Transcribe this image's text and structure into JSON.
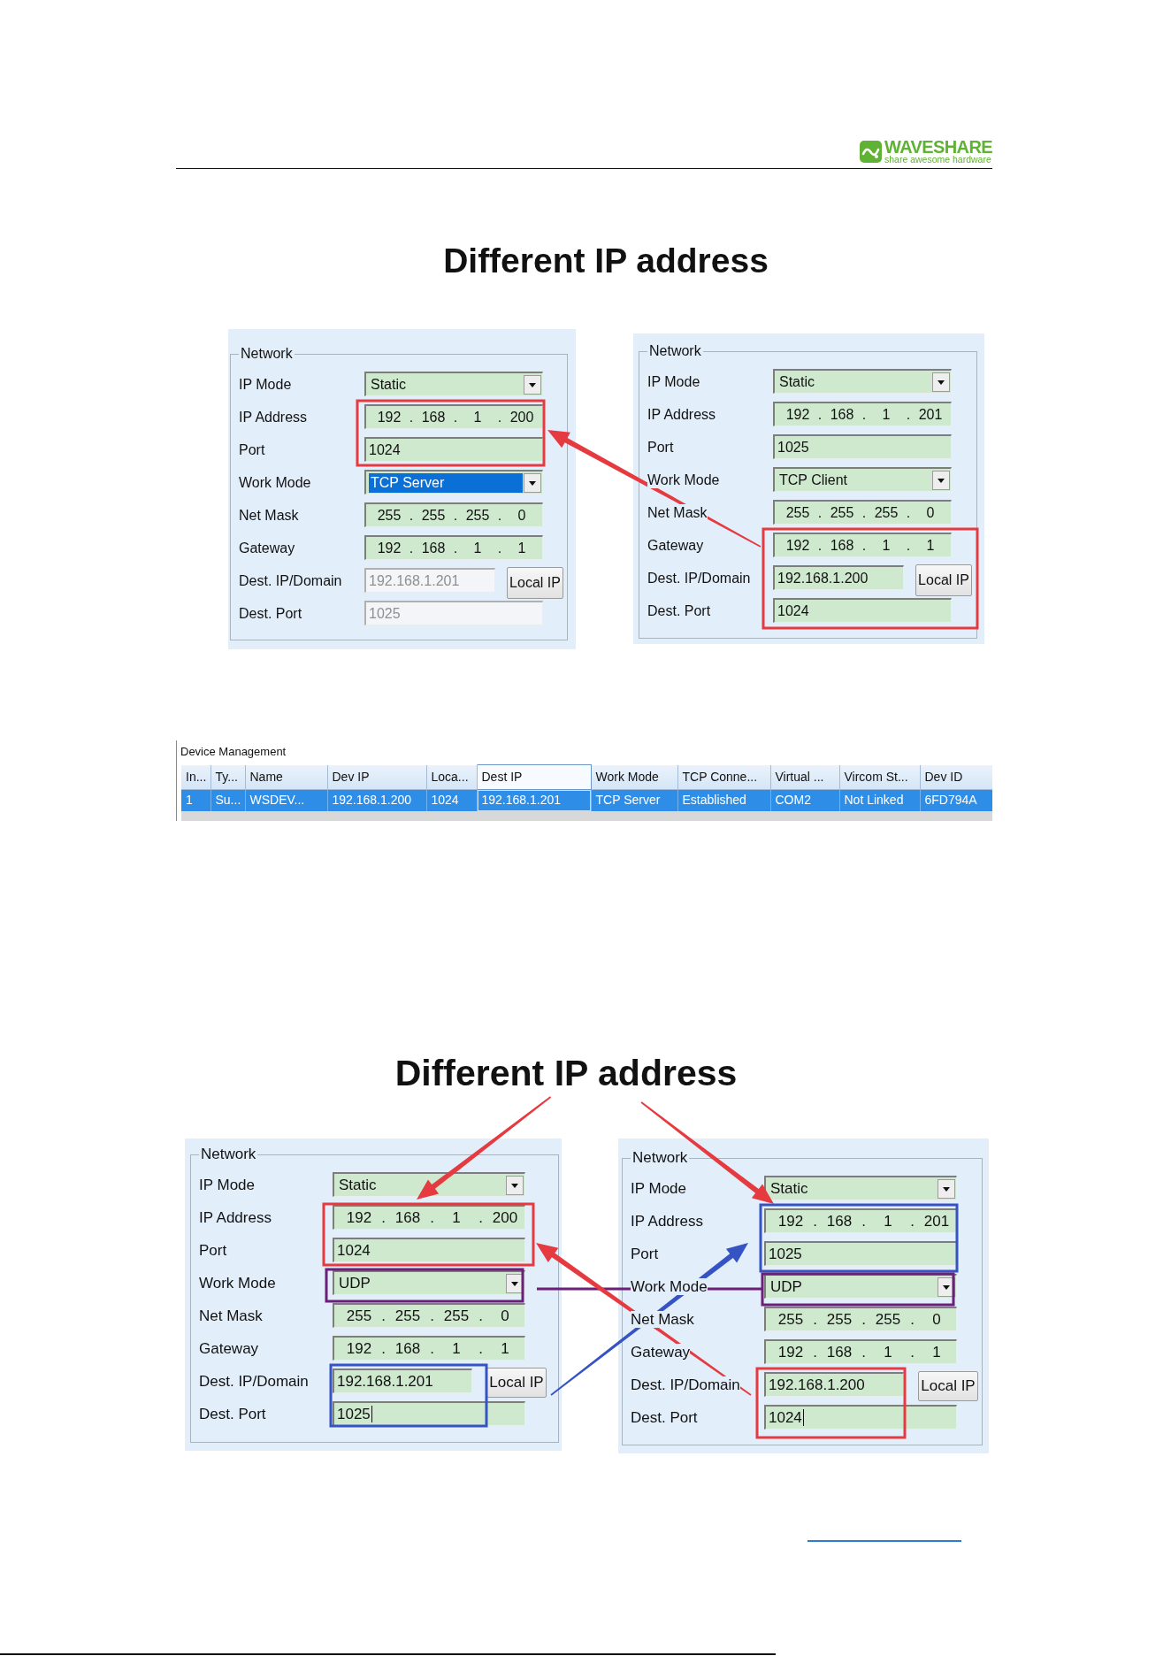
{
  "blocks": [
    {
      "kind": "header",
      "brand": "WAVESHARE",
      "tagline": "share awesome hardware"
    },
    {
      "kind": "figure",
      "title": "Different IP address",
      "panels": [
        {
          "group": "Network",
          "rows": [
            {
              "label": "IP Mode",
              "kind": "combo",
              "value": "Static",
              "disabled": false,
              "focused": false
            },
            {
              "label": "IP Address",
              "kind": "ip",
              "value": "192 . 168 . 1 . 200",
              "disabled": false,
              "focused": false
            },
            {
              "label": "Port",
              "kind": "text",
              "value": "1024",
              "disabled": false,
              "focused": false
            },
            {
              "label": "Work Mode",
              "kind": "combo",
              "value": "TCP Server",
              "disabled": false,
              "focused": true
            },
            {
              "label": "Net Mask",
              "kind": "ip",
              "value": "255 . 255 . 255 . 0",
              "disabled": false,
              "focused": false
            },
            {
              "label": "Gateway",
              "kind": "ip",
              "value": "192 . 168 . 1 . 1",
              "disabled": false,
              "focused": false
            },
            {
              "label": "Dest. IP/Domain",
              "kind": "text",
              "value": "192.168.1.201",
              "button": "Local IP",
              "disabled": true,
              "focused": false
            },
            {
              "label": "Dest. Port",
              "kind": "text",
              "value": "1025",
              "disabled": true,
              "focused": false
            }
          ]
        },
        {
          "group": "Network",
          "rows": [
            {
              "label": "IP Mode",
              "kind": "combo",
              "value": "Static",
              "disabled": false,
              "focused": false
            },
            {
              "label": "IP Address",
              "kind": "ip",
              "value": "192 . 168 . 1 . 201",
              "disabled": false,
              "focused": false
            },
            {
              "label": "Port",
              "kind": "text",
              "value": "1025",
              "disabled": false,
              "focused": false
            },
            {
              "label": "Work Mode",
              "kind": "combo",
              "value": "TCP Client",
              "disabled": false,
              "focused": false
            },
            {
              "label": "Net Mask",
              "kind": "ip",
              "value": "255 . 255 . 255 . 0",
              "disabled": false,
              "focused": false
            },
            {
              "label": "Gateway",
              "kind": "ip",
              "value": "192 . 168 . 1 . 1",
              "disabled": false,
              "focused": false
            },
            {
              "label": "Dest. IP/Domain",
              "kind": "text",
              "value": "192.168.1.200",
              "button": "Local IP",
              "disabled": false,
              "focused": false
            },
            {
              "label": "Dest. Port",
              "kind": "text",
              "value": "1024",
              "disabled": false,
              "focused": false
            }
          ]
        }
      ],
      "annotations": [
        {
          "kind": "box",
          "color": "#e53a40"
        },
        {
          "kind": "box",
          "color": "#e53a40"
        },
        {
          "kind": "arrow",
          "color": "#e53a40"
        }
      ]
    },
    {
      "kind": "table",
      "title": "Device Management",
      "columns": [
        {
          "label": "In...",
          "selected": false
        },
        {
          "label": "Ty...",
          "selected": false
        },
        {
          "label": "Name",
          "selected": false
        },
        {
          "label": "Dev IP",
          "selected": false
        },
        {
          "label": "Loca...",
          "selected": false
        },
        {
          "label": "Dest IP",
          "selected": true
        },
        {
          "label": "Work Mode",
          "selected": false
        },
        {
          "label": "TCP Conne...",
          "selected": false
        },
        {
          "label": "Virtual ...",
          "selected": false
        },
        {
          "label": "Vircom St...",
          "selected": false
        },
        {
          "label": "Dev ID",
          "selected": false
        }
      ],
      "rows": [
        {
          "selected": true,
          "cells": [
            "1",
            "Su...",
            "WSDEV...",
            "192.168.1.200",
            "1024",
            "192.168.1.201",
            "TCP Server",
            "Established",
            "COM2",
            "Not Linked",
            "6FD794A"
          ]
        }
      ]
    },
    {
      "kind": "figure",
      "title": "Different IP address",
      "panels": [
        {
          "group": "Network",
          "rows": [
            {
              "label": "IP Mode",
              "kind": "combo",
              "value": "Static",
              "disabled": false,
              "focused": false
            },
            {
              "label": "IP Address",
              "kind": "ip",
              "value": "192 . 168 . 1 . 200",
              "disabled": false,
              "focused": false
            },
            {
              "label": "Port",
              "kind": "text",
              "value": "1024",
              "disabled": false,
              "focused": false
            },
            {
              "label": "Work Mode",
              "kind": "combo",
              "value": "UDP",
              "disabled": false,
              "focused": false
            },
            {
              "label": "Net Mask",
              "kind": "ip",
              "value": "255 . 255 . 255 . 0",
              "disabled": false,
              "focused": false
            },
            {
              "label": "Gateway",
              "kind": "ip",
              "value": "192 . 168 . 1 . 1",
              "disabled": false,
              "focused": false
            },
            {
              "label": "Dest. IP/Domain",
              "kind": "text",
              "value": "192.168.1.201",
              "button": "Local IP",
              "disabled": false,
              "focused": false
            },
            {
              "label": "Dest. Port",
              "kind": "text",
              "value": "1025",
              "disabled": false,
              "focused": true
            }
          ]
        },
        {
          "group": "Network",
          "rows": [
            {
              "label": "IP Mode",
              "kind": "combo",
              "value": "Static",
              "disabled": false,
              "focused": false
            },
            {
              "label": "IP Address",
              "kind": "ip",
              "value": "192 . 168 . 1 . 201",
              "disabled": false,
              "focused": false
            },
            {
              "label": "Port",
              "kind": "text",
              "value": "1025",
              "disabled": false,
              "focused": false
            },
            {
              "label": "Work Mode",
              "kind": "combo",
              "value": "UDP",
              "disabled": false,
              "focused": false
            },
            {
              "label": "Net Mask",
              "kind": "ip",
              "value": "255 . 255 . 255 . 0",
              "disabled": false,
              "focused": false
            },
            {
              "label": "Gateway",
              "kind": "ip",
              "value": "192 . 168 . 1 . 1",
              "disabled": false,
              "focused": false
            },
            {
              "label": "Dest. IP/Domain",
              "kind": "text",
              "value": "192.168.1.200",
              "button": "Local IP",
              "disabled": false,
              "focused": false
            },
            {
              "label": "Dest. Port",
              "kind": "text",
              "value": "1024",
              "disabled": false,
              "focused": true
            }
          ]
        }
      ],
      "annotations": [
        {
          "kind": "arrow",
          "color": "#e53a40"
        },
        {
          "kind": "arrow",
          "color": "#e53a40"
        },
        {
          "kind": "box",
          "color": "#e53a40"
        },
        {
          "kind": "box",
          "color": "#6b1f78"
        },
        {
          "kind": "box",
          "color": "#3653c4"
        },
        {
          "kind": "box",
          "color": "#3653c4"
        },
        {
          "kind": "box",
          "color": "#6b1f78"
        },
        {
          "kind": "box",
          "color": "#e53a40"
        },
        {
          "kind": "line",
          "color": "#6b1f78"
        },
        {
          "kind": "arrow",
          "color": "#e53a40"
        },
        {
          "kind": "arrow",
          "color": "#3653c4"
        }
      ]
    }
  ]
}
